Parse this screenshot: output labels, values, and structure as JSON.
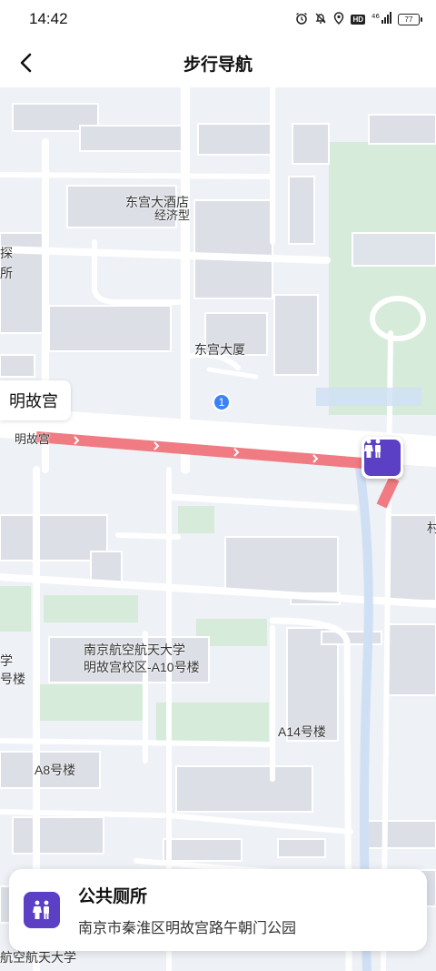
{
  "status_bar": {
    "time": "14:42",
    "network": "⁴⁶",
    "hd": "HD",
    "battery": "77"
  },
  "nav": {
    "title": "步行导航"
  },
  "map": {
    "poi_chip": "明故宫",
    "labels": {
      "hotel": "东宫大酒店",
      "hotel_sub": "经济型",
      "dong_gong_building": "东宫大厦",
      "road_left": "明故宫",
      "left_edge_1": "探",
      "left_edge_2": "所",
      "univ_line1": "南京航空航天大学",
      "univ_line2": "明故宫校区-A10号楼",
      "a14": "A14号楼",
      "a8": "A8号楼",
      "left_xue": "学",
      "left_hao": "号楼",
      "right_edge": "村",
      "bottom_univ": "航空航天大学"
    },
    "step_number": "1",
    "route_color": "#f07b82",
    "toilet_color": "#5b3fc4"
  },
  "card": {
    "title": "公共厕所",
    "address": "南京市秦淮区明故宫路午朝门公园"
  }
}
